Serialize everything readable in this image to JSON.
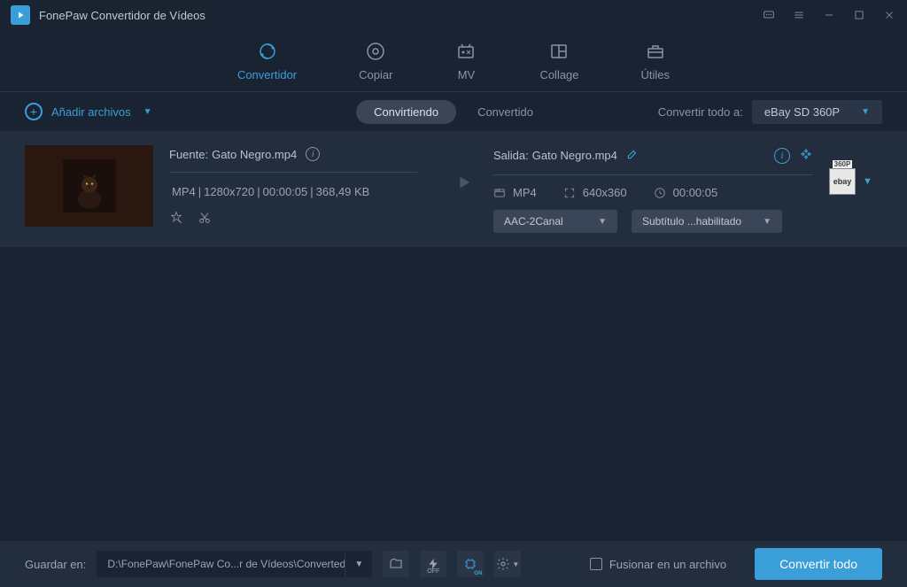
{
  "title": "FonePaw Convertidor de Vídeos",
  "nav": {
    "convertidor": "Convertidor",
    "copiar": "Copiar",
    "mv": "MV",
    "collage": "Collage",
    "utiles": "Útiles"
  },
  "toolbar": {
    "add_files": "Añadir archivos",
    "tab_converting": "Convirtiendo",
    "tab_converted": "Convertido",
    "convert_all_to": "Convertir todo a:",
    "profile": "eBay SD 360P"
  },
  "file": {
    "source_label": "Fuente:",
    "source_name": "Gato Negro.mp4",
    "format": "MP4",
    "resolution": "1280x720",
    "duration": "00:00:05",
    "size": "368,49 KB",
    "output_label": "Salida:",
    "output_name": "Gato Negro.mp4",
    "out_format": "MP4",
    "out_resolution": "640x360",
    "out_duration": "00:00:05",
    "audio_dd": "AAC-2Canal",
    "subtitle_dd": "Subtítulo ...habilitado",
    "badge_res": "360P",
    "badge_brand": "ebay"
  },
  "footer": {
    "save_to": "Guardar en:",
    "path": "D:\\FonePaw\\FonePaw Co...r de Vídeos\\Converted",
    "merge": "Fusionar en un archivo",
    "convert_all": "Convertir todo"
  }
}
